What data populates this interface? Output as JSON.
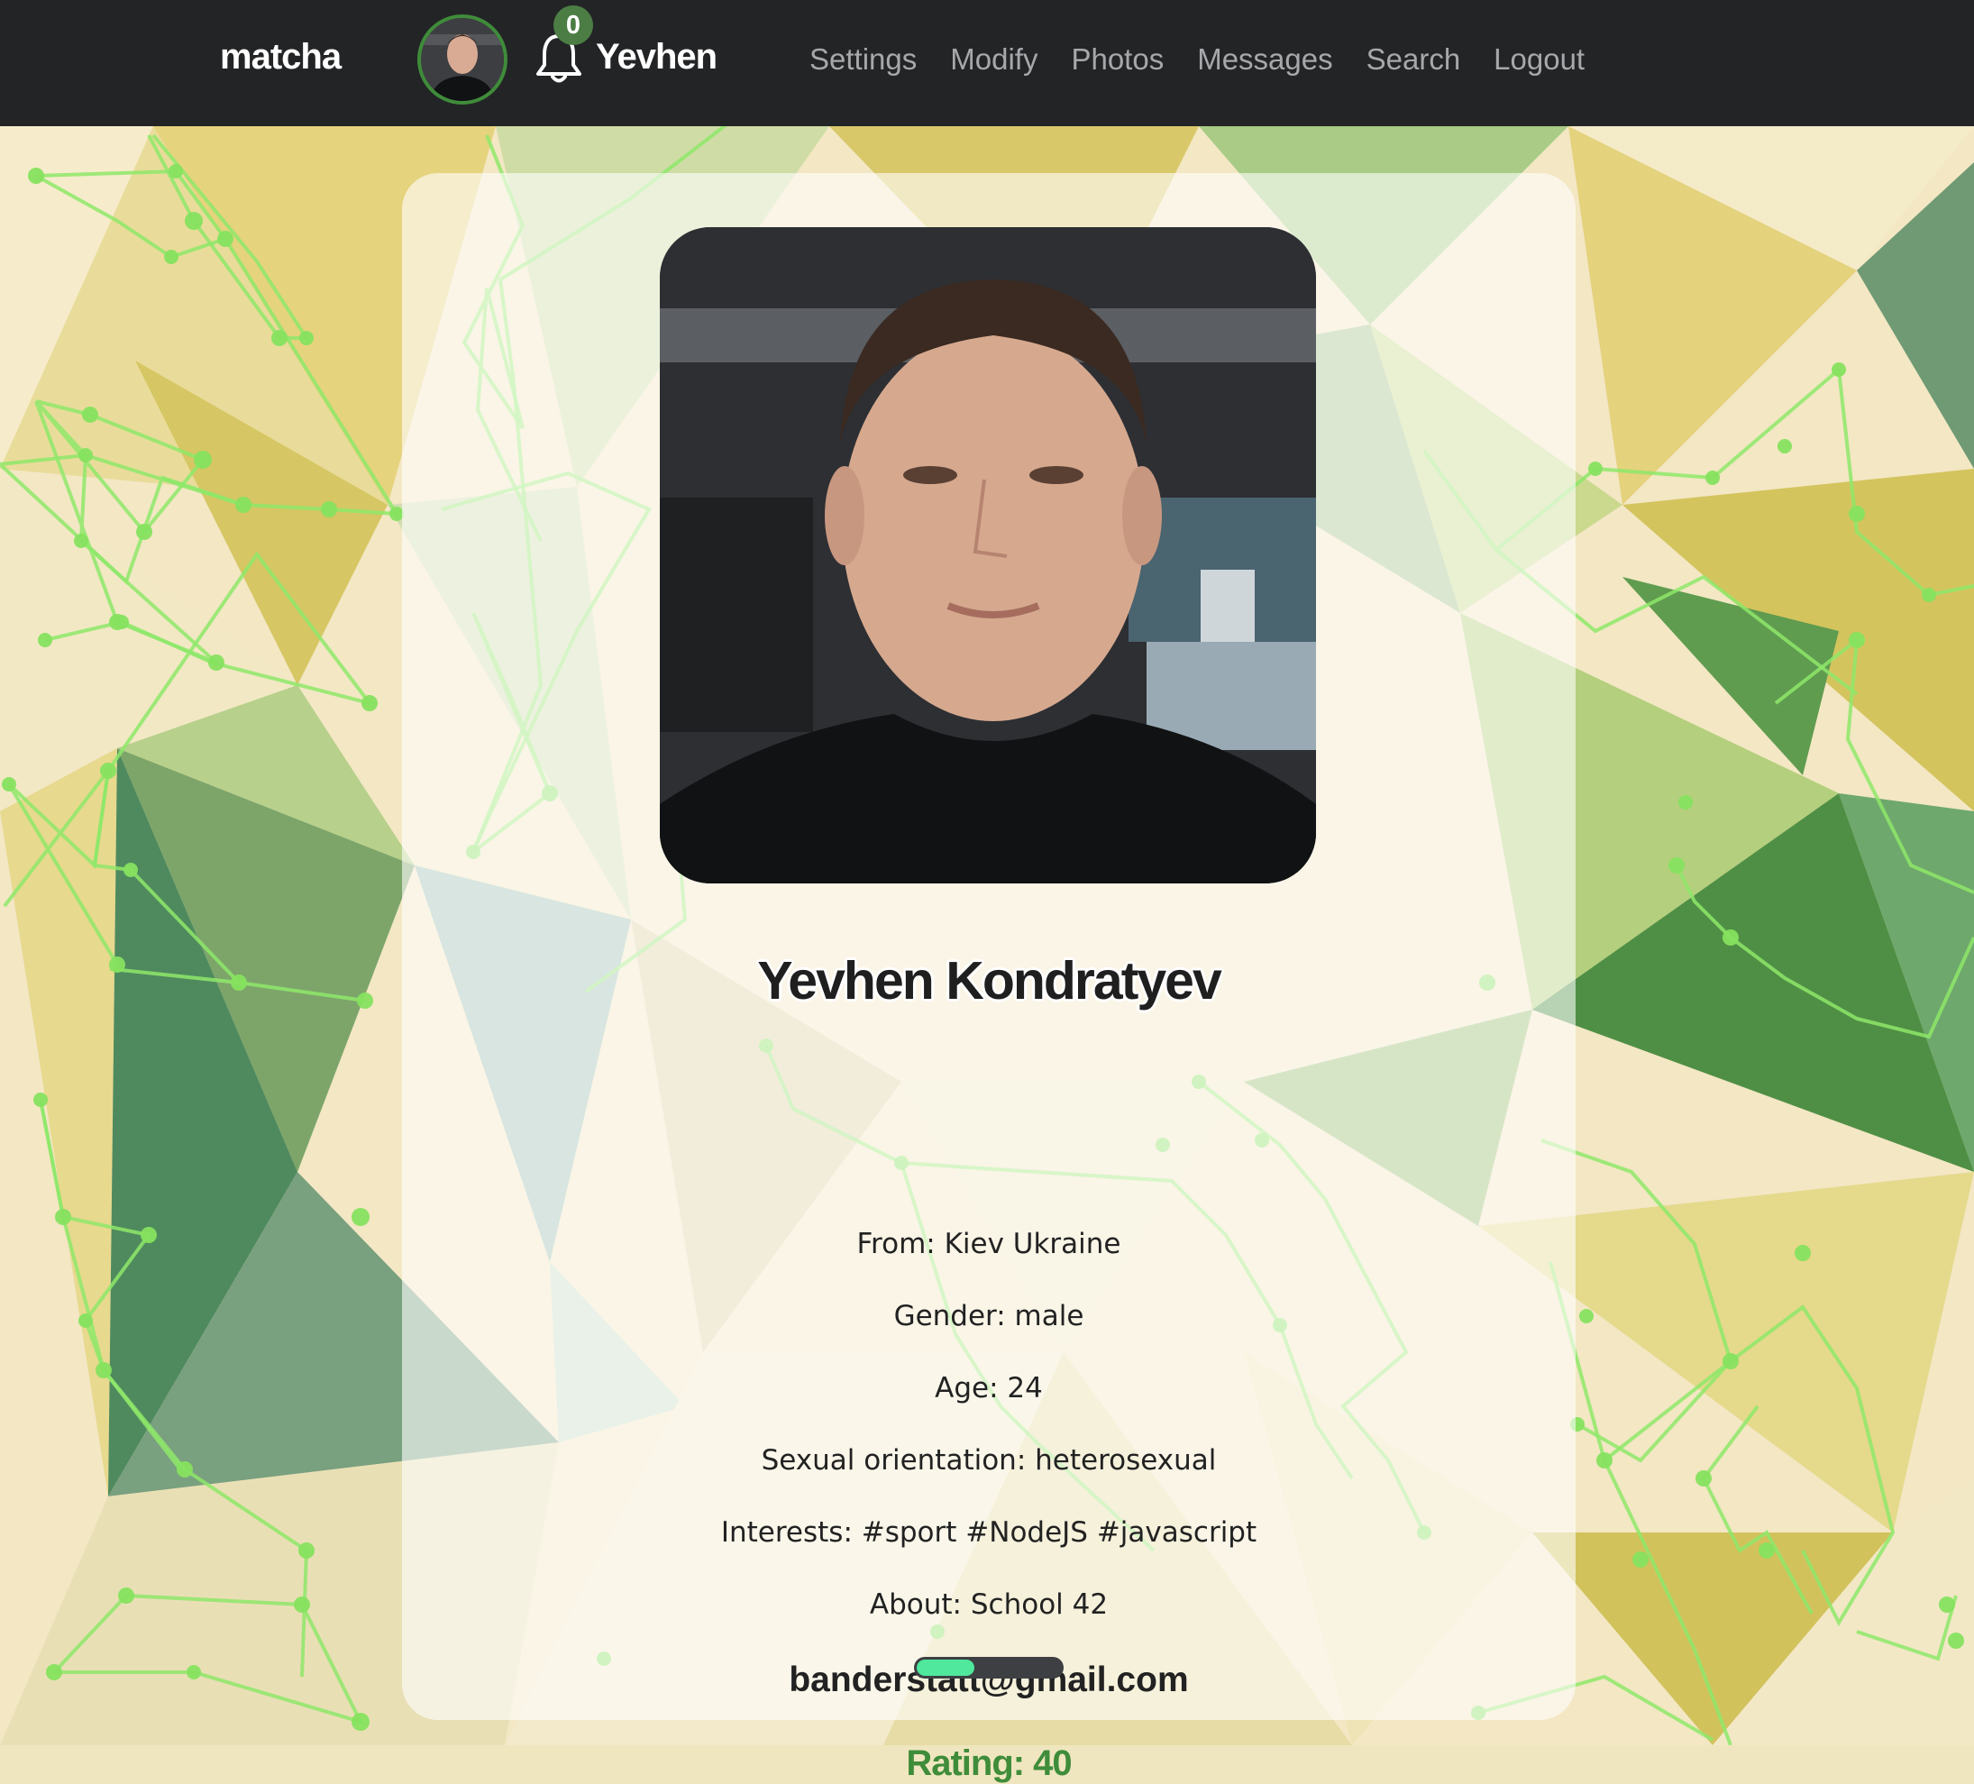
{
  "navbar": {
    "brand": "matcha",
    "notifications_count": "0",
    "username": "Yevhen",
    "links": [
      "Settings",
      "Modify",
      "Photos",
      "Messages",
      "Search",
      "Logout"
    ]
  },
  "profile": {
    "full_name": "Yevhen Kondratyev",
    "from": "From: Kiev Ukraine",
    "gender": "Gender: male",
    "age": "Age: 24",
    "orientation": "Sexual orientation: heterosexual",
    "interests": "Interests: #sport #NodeJS #javascript",
    "about": "About: School 42",
    "email": "banderstatt@gmail.com",
    "rating_label": "Rating: 40",
    "rating_fraction": 0.4
  },
  "colors": {
    "navbar_bg": "#232426",
    "accent_green": "#3f8c3a",
    "nav_link": "#a6a8ab",
    "rating_fill": "#4fe89c"
  }
}
